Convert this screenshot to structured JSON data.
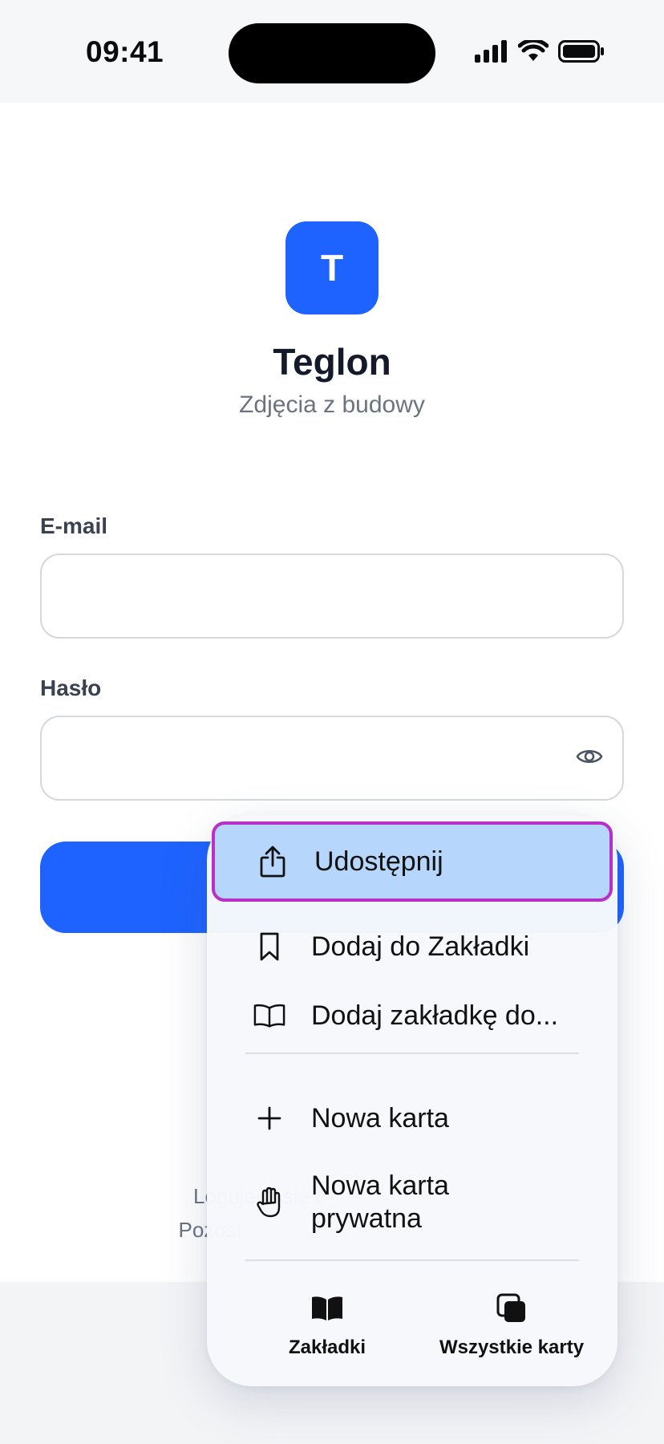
{
  "status_bar": {
    "time": "09:41",
    "icons": [
      "cellular-signal-icon",
      "wifi-icon",
      "battery-icon"
    ]
  },
  "app": {
    "logo_letter": "T",
    "name": "Teglon",
    "subtitle": "Zdjęcia z budowy",
    "accent_color": "#1e63ff"
  },
  "form": {
    "email_label": "E-mail",
    "email_value": "",
    "password_label": "Hasło",
    "password_value": "",
    "login_button_label": ""
  },
  "footer": {
    "line1": "Logujesz się t",
    "line2": "Pozost"
  },
  "context_menu": {
    "items": [
      {
        "label": "Udostępnij",
        "icon": "share-icon",
        "highlighted": true
      },
      {
        "label": "Dodaj do Zakładki",
        "icon": "bookmark-icon"
      },
      {
        "label": "Dodaj zakładkę do...",
        "icon": "book-open-icon"
      },
      {
        "label": "Nowa karta",
        "icon": "plus-icon"
      },
      {
        "label": "Nowa karta prywatna",
        "icon": "hand-icon"
      }
    ],
    "tabs": [
      {
        "label": "Zakładki",
        "icon": "bookmarks-book-icon"
      },
      {
        "label": "Wszystkie karty",
        "icon": "all-tabs-icon"
      }
    ],
    "highlight_border_color": "#b92fc9",
    "highlight_fill_color": "#b7d6fc"
  }
}
